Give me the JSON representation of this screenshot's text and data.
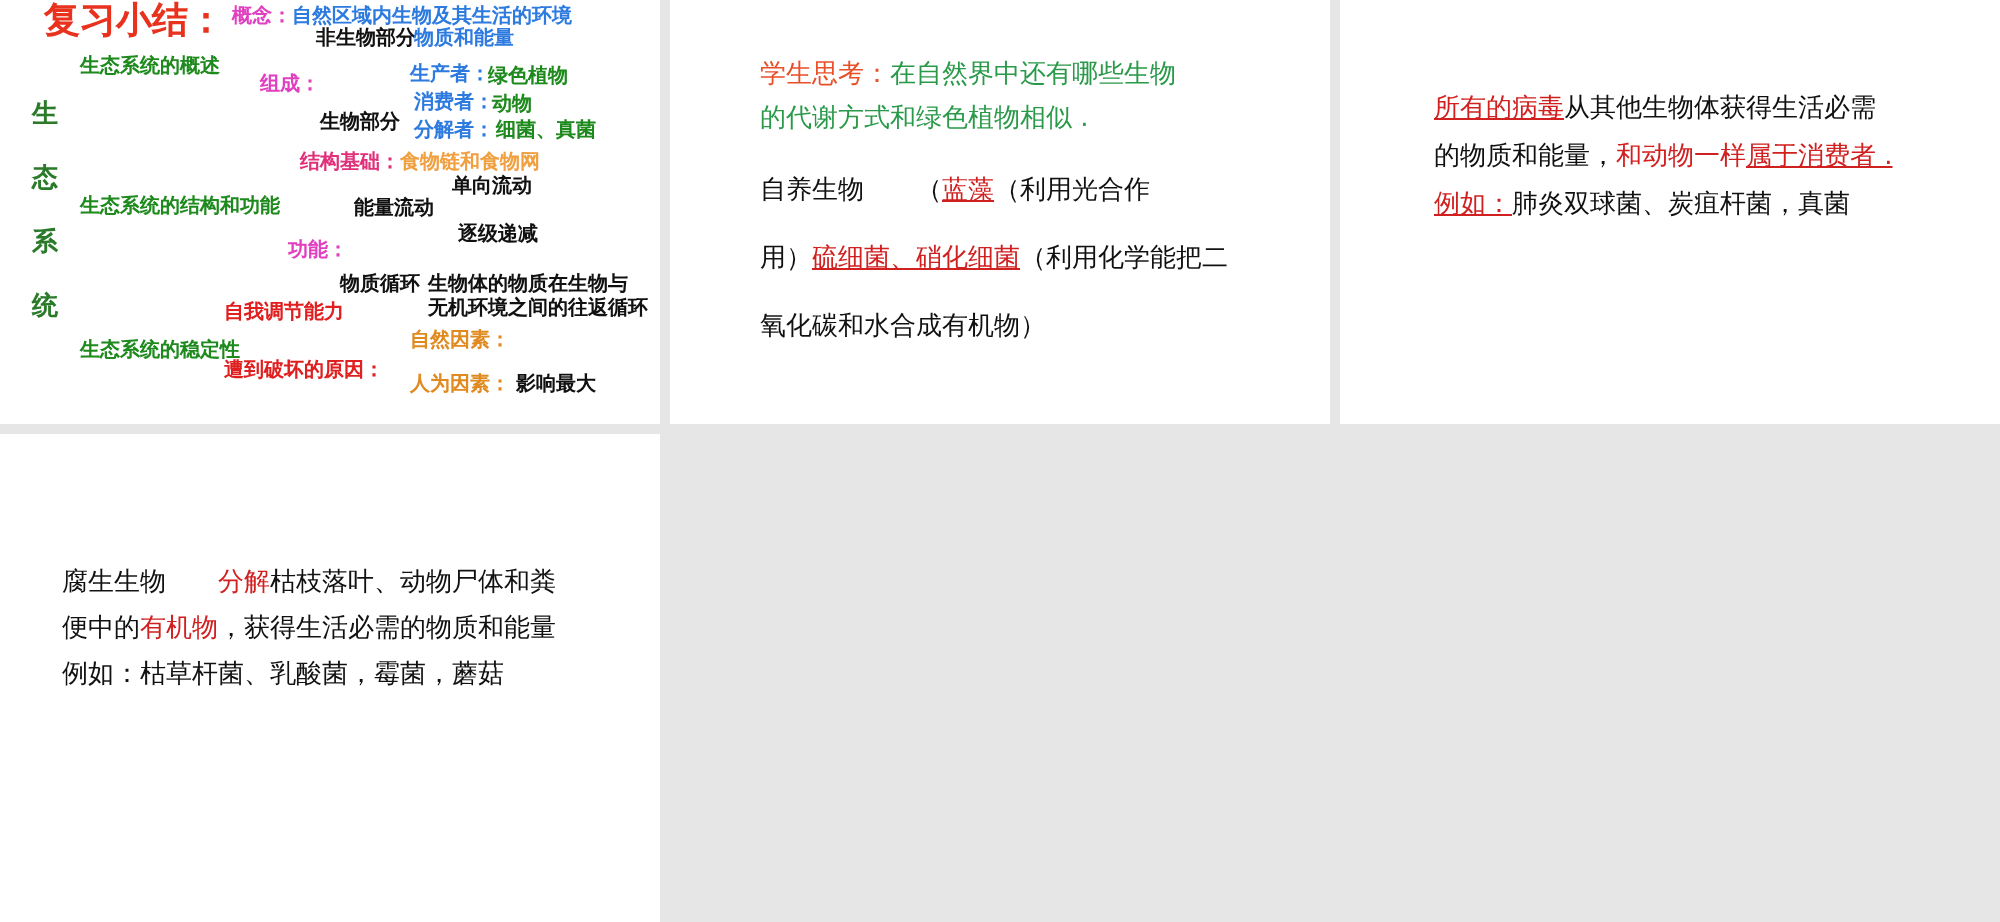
{
  "slides": [
    {
      "kind": "mindmap",
      "items": [
        {
          "text": "复习小结：",
          "color": "#e8321e"
        },
        {
          "text": "概念：",
          "color": "#e040c0"
        },
        {
          "text": "自然区域内生物及其生活的环境",
          "color": "#2e7be0"
        },
        {
          "text": "非生物部分",
          "color": "#111111"
        },
        {
          "text": "物质和能量",
          "color": "#2e7be0"
        },
        {
          "text": "生态系统的概述",
          "color": "#1e8a1e"
        },
        {
          "text": "组成：",
          "color": "#e040c0"
        },
        {
          "text": "生产者：",
          "color": "#2e7be0"
        },
        {
          "text": "绿色植物",
          "color": "#1e8a1e"
        },
        {
          "text": "消费者：",
          "color": "#2e7be0"
        },
        {
          "text": "动物",
          "color": "#1e8a1e"
        },
        {
          "text": "生物部分",
          "color": "#111111"
        },
        {
          "text": "分解者：",
          "color": "#2e7be0"
        },
        {
          "text": "细菌、真菌",
          "color": "#1e8a1e"
        },
        {
          "text": "结构基础：",
          "color": "#e0307a"
        },
        {
          "text": "食物链和食物网",
          "color": "#f0a040"
        },
        {
          "text": "单向流动",
          "color": "#111111"
        },
        {
          "text": "生态系统的结构和功能",
          "color": "#1e8a1e"
        },
        {
          "text": "能量流动",
          "color": "#111111"
        },
        {
          "text": "逐级递减",
          "color": "#111111"
        },
        {
          "text": "功能：",
          "color": "#e040c0"
        },
        {
          "text": "物质循环",
          "color": "#111111"
        },
        {
          "text": "生物体的物质在生物与",
          "color": "#111111"
        },
        {
          "text": "自我调节能力",
          "color": "#e02020"
        },
        {
          "text": "无机环境之间的往返循环",
          "color": "#111111"
        },
        {
          "text": "生态系统的稳定性",
          "color": "#1e8a1e"
        },
        {
          "text": "自然因素：",
          "color": "#e08a20"
        },
        {
          "text": "遭到破坏的原因：",
          "color": "#e02020"
        },
        {
          "text": "人为因素：",
          "color": "#e08a20"
        },
        {
          "text": "影响最大",
          "color": "#111111"
        }
      ],
      "side_title": "生态系统"
    },
    {
      "kind": "text",
      "paragraphs": [
        {
          "lines": [
            [
              {
                "text": "学生思考：",
                "color": "#e8502a"
              },
              {
                "text": "在自然界中还有哪些生物",
                "color": "#2a9a4a"
              }
            ],
            [
              {
                "text": "的代谢方式和绿色植物相似 .",
                "color": "#2a9a4a"
              }
            ]
          ]
        },
        {
          "lines": [
            [
              {
                "text": "自养生物"
              },
              {
                "text": "　　（"
              },
              {
                "text": "蓝藻",
                "color": "#d02020",
                "underline": true
              },
              {
                "text": "（利用光合作"
              }
            ],
            [
              {
                "text": "用）"
              },
              {
                "text": "硫细菌、硝化细菌",
                "color": "#d02020",
                "underline": true
              },
              {
                "text": "（利用化学能把二"
              }
            ],
            [
              {
                "text": "氧化碳和水合成有机物）"
              }
            ]
          ]
        }
      ]
    },
    {
      "kind": "text",
      "paragraphs": [
        {
          "lines": [
            [
              {
                "text": "所有的病毒",
                "color": "#d02020",
                "underline": true
              },
              {
                "text": "从其他生物体获得生活必需"
              }
            ],
            [
              {
                "text": "的物质和能量，"
              },
              {
                "text": "和动物一样",
                "color": "#d02020"
              },
              {
                "text": "属于消费者 .",
                "color": "#d02020",
                "underline": true
              }
            ],
            [
              {
                "text": "例如：",
                "color": "#d02020",
                "underline": true
              },
              {
                "text": "肺炎双球菌、炭疽杆菌，真菌"
              }
            ]
          ]
        }
      ]
    },
    {
      "kind": "text",
      "paragraphs": [
        {
          "lines": [
            [
              {
                "text": "腐生生物"
              },
              {
                "text": "　　分解",
                "color": "#d02020"
              },
              {
                "text": "枯枝落叶、动物尸体和粪"
              }
            ],
            [
              {
                "text": "便中的"
              },
              {
                "text": "有机物",
                "color": "#d02020"
              },
              {
                "text": "，获得生活必需的物质和能量"
              }
            ],
            [
              {
                "text": "例如：枯草杆菌、乳酸菌，霉菌，蘑菇"
              }
            ]
          ]
        }
      ]
    }
  ]
}
